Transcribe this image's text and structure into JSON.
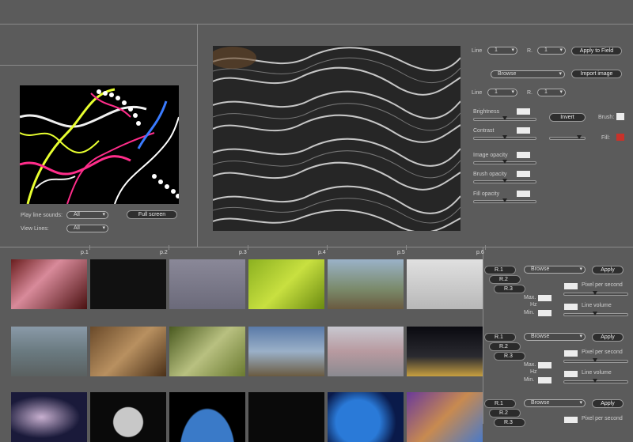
{
  "left_panel": {
    "play_line_sounds_label": "Play line sounds:",
    "play_line_sounds_value": "All",
    "view_lines_label": "View Lines:",
    "view_lines_value": "All",
    "full_screen_label": "Full screen"
  },
  "right_controls": {
    "line_label_1": "Line",
    "line_value_1": "1",
    "r_label": "R.",
    "r_value": "1",
    "apply_to_field": "Apply to Field",
    "browse_value": "Browse",
    "import_image": "Import image",
    "line_label_2": "Line",
    "line_value_2": "1",
    "r_label_2": "R.",
    "r_value_2": "1",
    "brightness": "Brightness",
    "contrast": "Contrast",
    "image_opacity": "Image opacity",
    "brush_opacity": "Brush opacity",
    "fill_opacity": "Fill opacity",
    "invert": "Invert",
    "brush": "Brush:",
    "fill": "Fill:"
  },
  "gallery": {
    "row_labels": [
      "p.1",
      "p.2",
      "p.3",
      "p.4",
      "p.5",
      "p.6"
    ]
  },
  "sound_panels": [
    {
      "tabs": [
        "R.1",
        "R.2",
        "R.3"
      ],
      "browse": "Browse",
      "apply": "Apply",
      "pixel_per_second": "Pixel per second",
      "max": "Max.",
      "hz": "Hz",
      "min": "Min.",
      "line_volume": "Line volume"
    },
    {
      "tabs": [
        "R.1",
        "R.2",
        "R.3"
      ],
      "browse": "Browse",
      "apply": "Apply",
      "pixel_per_second": "Pixel per second",
      "max": "Max.",
      "hz": "Hz",
      "min": "Min.",
      "line_volume": "Line volume"
    },
    {
      "tabs": [
        "R.1",
        "R.2",
        "R.3"
      ],
      "browse": "Browse",
      "apply": "Apply",
      "pixel_per_second": "Pixel per second"
    }
  ],
  "colors": {
    "fill_swatch": "#c8322a",
    "brush_swatch": "#ececec"
  }
}
